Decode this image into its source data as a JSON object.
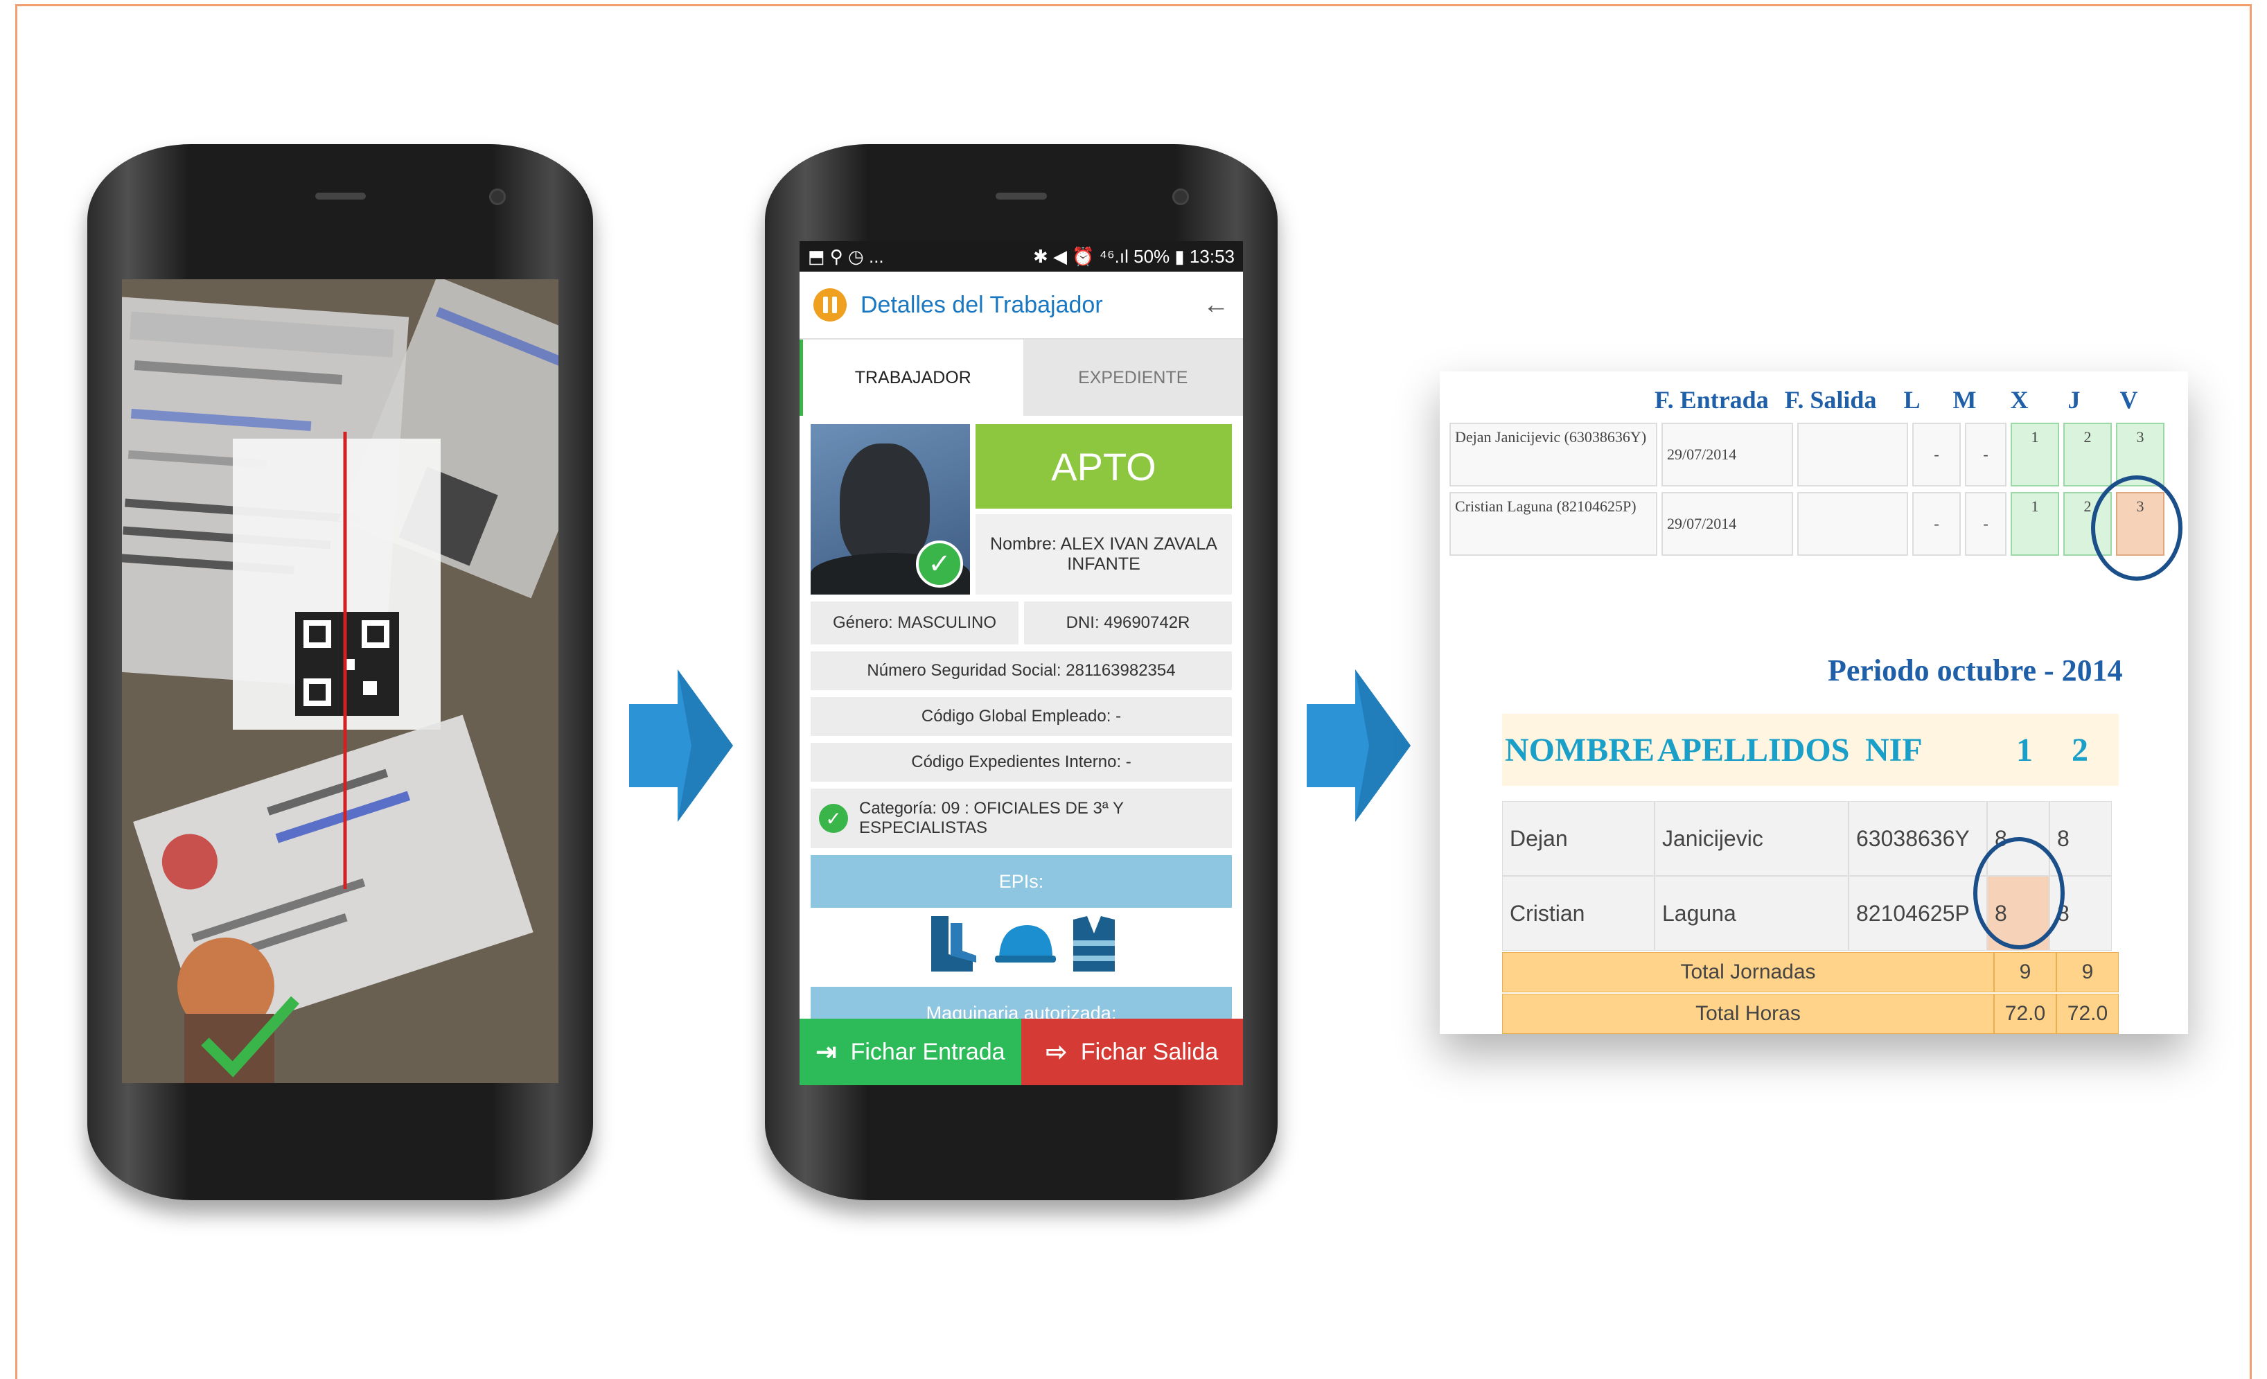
{
  "phone2": {
    "status_left": "⬒ ⚲ ◷ ...",
    "status_right": "✱ ◀ ⏰ ⁴⁶.ıl 50% ▮ 13:53",
    "title": "Detalles del Trabajador",
    "back_icon": "←",
    "tabs": [
      "TRABAJADOR",
      "EXPEDIENTE"
    ],
    "status": "APTO",
    "nombre": "Nombre: ALEX IVAN ZAVALA INFANTE",
    "genero": "Género: MASCULINO",
    "dni": "DNI: 49690742R",
    "nss": "Número Seguridad Social: 281163982354",
    "codigo_global": "Código Global Empleado: -",
    "codigo_expediente": "Código Expedientes Interno: -",
    "categoria": "Categoría: 09 : OFICIALES DE 3ª Y ESPECIALISTAS",
    "epis_label": "EPIs:",
    "maquinaria_label": "Maquinaria autorizada:",
    "btn_entrada": "Fichar Entrada",
    "btn_salida": "Fichar Salida"
  },
  "sheet": {
    "headers": [
      "F. Entrada",
      "F. Salida",
      "L",
      "M",
      "X",
      "J",
      "V"
    ],
    "rows": [
      {
        "name": "Dejan Janicijevic (63038636Y)",
        "entrada": "29/07/2014",
        "l": "-",
        "m": "-",
        "x": "1",
        "j": "2",
        "v": "3"
      },
      {
        "name": "Cristian Laguna (82104625P)",
        "entrada": "29/07/2014",
        "l": "-",
        "m": "-",
        "x": "1",
        "j": "2",
        "v": "3"
      }
    ],
    "period": "Periodo octubre - 2014",
    "t2_headers": [
      "NOMBRE",
      "APELLIDOS",
      "NIF",
      "1",
      "2"
    ],
    "t2_rows": [
      {
        "nombre": "Dejan",
        "apellidos": "Janicijevic",
        "nif": "63038636Y",
        "d1": "8",
        "d2": "8"
      },
      {
        "nombre": "Cristian",
        "apellidos": "Laguna",
        "nif": "82104625P",
        "d1": "8",
        "d2": "8"
      }
    ],
    "total_jornadas_label": "Total Jornadas",
    "total_jornadas": [
      "9",
      "9"
    ],
    "total_horas_label": "Total Horas",
    "total_horas": [
      "72.0",
      "72.0"
    ]
  }
}
